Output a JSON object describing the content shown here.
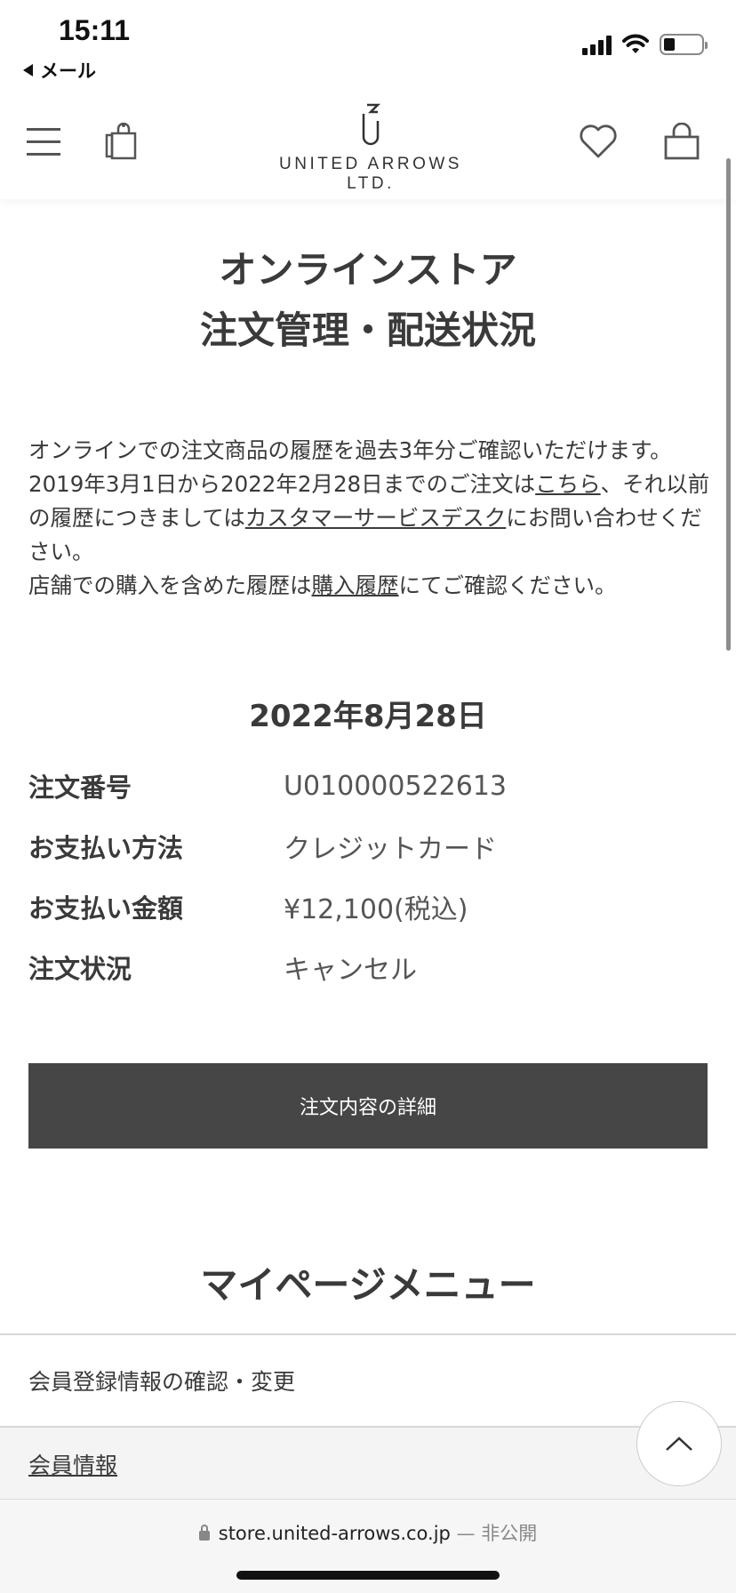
{
  "status_bar": {
    "time": "15:11",
    "back_app": "メール"
  },
  "header": {
    "logo_text": "UNITED ARROWS LTD.",
    "icons": [
      "menu-icon",
      "shopping-bag-icon",
      "heart-icon",
      "cart-icon"
    ]
  },
  "page": {
    "title_line1": "オンラインストア",
    "title_line2": "注文管理・配送状況",
    "intro": {
      "p1": "オンラインでの注文商品の履歴を過去3年分ご確認いただけます。",
      "p2_before": "2019年3月1日から2022年2月28日までのご注文は",
      "p2_link": "こちら",
      "p2_middle": "、それ以前の履歴につきましては",
      "p2_link2": "カスタマーサービスデスク",
      "p2_after": "にお問い合わせください。",
      "p3_before": "店舗での購入を含めた履歴は",
      "p3_link": "購入履歴",
      "p3_after": "にてご確認ください。"
    }
  },
  "order": {
    "date": "2022年8月28日",
    "rows": [
      {
        "label": "注文番号",
        "value": "U010000522613"
      },
      {
        "label": "お支払い方法",
        "value": "クレジットカード"
      },
      {
        "label": "お支払い金額",
        "value": "¥12,100(税込)"
      },
      {
        "label": "注文状況",
        "value": "キャンセル"
      }
    ],
    "detail_button": "注文内容の詳細"
  },
  "mypage_menu": {
    "title": "マイページメニュー",
    "items": [
      {
        "label": "会員登録情報の確認・変更"
      },
      {
        "label": "会員情報"
      }
    ]
  },
  "browser": {
    "url": "store.united-arrows.co.jp",
    "separator": " — ",
    "privacy": "非公開"
  }
}
